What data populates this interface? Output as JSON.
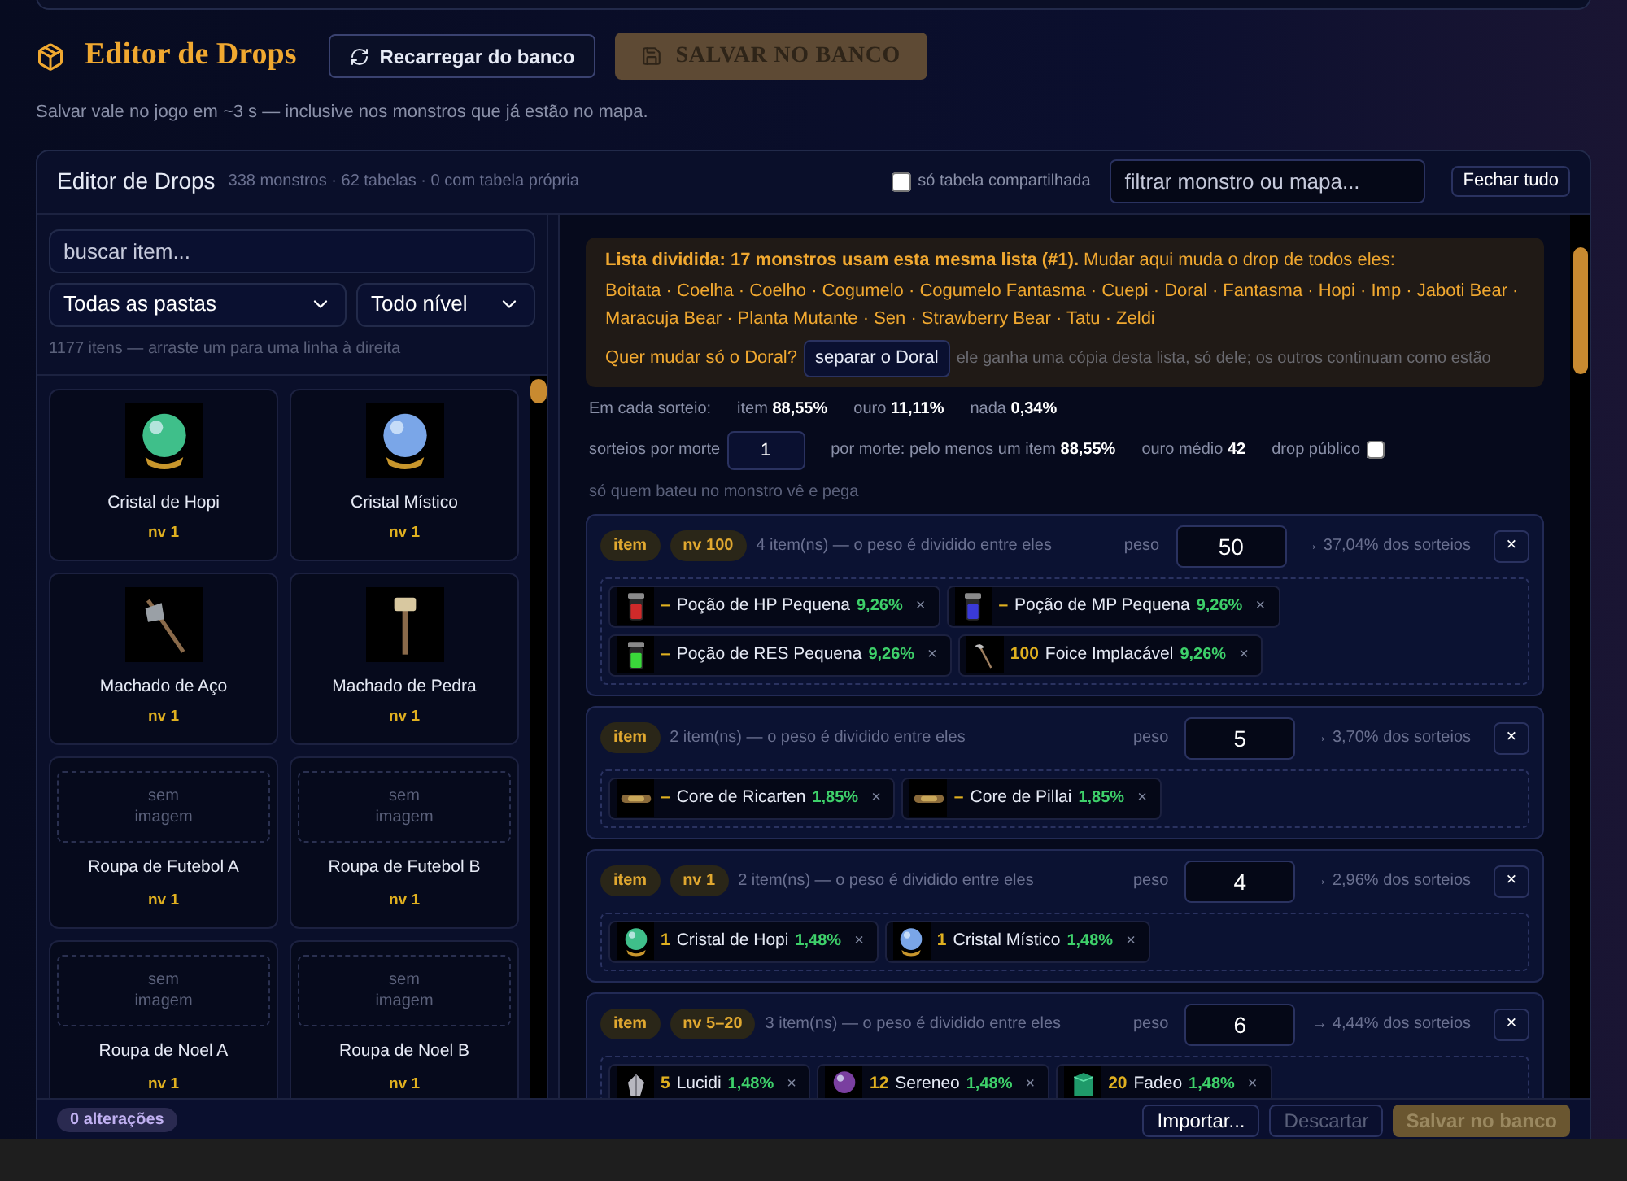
{
  "header": {
    "title": "Editor de Drops",
    "reload_button": "Recarregar do banco",
    "save_button": {
      "label": "SALVAR NO BANCO",
      "disabled": true
    },
    "subtitle": "Salvar vale no jogo em ~3 s — inclusive nos monstros que já estão no mapa."
  },
  "panel": {
    "title": "Editor de Drops",
    "meta": "338 monstros · 62 tabelas · 0 com tabela própria",
    "shared_only": {
      "label": "só tabela compartilhada",
      "checked": false
    },
    "filter": {
      "placeholder": "filtrar monstro ou mapa..."
    },
    "close_all": "Fechar tudo"
  },
  "sidebar": {
    "search": {
      "placeholder": "buscar item..."
    },
    "folder_select": "Todas as pastas",
    "level_select": "Todo nível",
    "hint": "1177 itens — arraste um para uma linha à direita",
    "items": [
      {
        "kind": "image",
        "name": "Cristal de Hopi",
        "level": "nv 1"
      },
      {
        "kind": "image",
        "name": "Cristal Místico",
        "level": "nv 1"
      },
      {
        "kind": "image",
        "name": "Machado de Aço",
        "level": "nv 1"
      },
      {
        "kind": "image",
        "name": "Machado de Pedra",
        "level": "nv 1"
      },
      {
        "kind": "placeholder",
        "placeholder": "sem imagem",
        "name": "Roupa de Futebol A",
        "level": "nv 1"
      },
      {
        "kind": "placeholder",
        "placeholder": "sem imagem",
        "name": "Roupa de Futebol B",
        "level": "nv 1"
      },
      {
        "kind": "placeholder",
        "placeholder": "sem imagem",
        "name": "Roupa de Noel A",
        "level": "nv 1"
      },
      {
        "kind": "placeholder",
        "placeholder": "sem imagem",
        "name": "Roupa de Noel B",
        "level": "nv 1"
      }
    ]
  },
  "editor": {
    "notice": {
      "text": "**Lista dividida: 17 monstros usam esta mesma lista (#1).** Mudar aqui muda o drop de todos eles:",
      "monsters": "Boitata · Coelha · Coelho · Cogumelo · Cogumelo Fantasma · Cuepi · Doral · Fantasma · Hopi · Imp · Jaboti Bear · Maracuja Bear · Planta Mutante · Sen · Strawberry Bear · Tatu · Zeldi",
      "question": "Quer mudar só o Doral?",
      "split_button": "separar o Doral",
      "note": "ele ganha uma cópia desta lista, só dele; os outros continuam como estão"
    },
    "per_draw": {
      "label": "Em cada sorteio:",
      "stats": [
        "item **88,55%**",
        "ouro **11,11%**",
        "nada **0,34%**"
      ]
    },
    "per_kill": {
      "label": "sorteios por morte",
      "value": "1",
      "stats": [
        "por morte: pelo menos um item **88,55%**",
        "ouro médio **42**"
      ],
      "public_drop": {
        "label": "drop público",
        "checked": false
      }
    },
    "help": "só quem bateu no monstro vê e pega",
    "groups": [
      {
        "badges": [
          "item",
          "nv 100"
        ],
        "summary": "4 item(ns) — o peso é dividido entre eles",
        "weight_label": "peso",
        "weight": "50",
        "share": "→ 37,04% dos sorteios",
        "close": "×",
        "items": [
          {
            "qty": "–",
            "name": "Poção de HP Pequena",
            "pct": "9,26%",
            "remove": "×"
          },
          {
            "qty": "–",
            "name": "Poção de MP Pequena",
            "pct": "9,26%",
            "remove": "×"
          },
          {
            "qty": "–",
            "name": "Poção de RES Pequena",
            "pct": "9,26%",
            "remove": "×"
          },
          {
            "qty": "100",
            "name": "Foice Implacável",
            "pct": "9,26%",
            "remove": "×"
          }
        ]
      },
      {
        "badges": [
          "item"
        ],
        "summary": "2 item(ns) — o peso é dividido entre eles",
        "weight_label": "peso",
        "weight": "5",
        "share": "→ 3,70% dos sorteios",
        "close": "×",
        "items": [
          {
            "qty": "–",
            "name": "Core de Ricarten",
            "pct": "1,85%",
            "remove": "×"
          },
          {
            "qty": "–",
            "name": "Core de Pillai",
            "pct": "1,85%",
            "remove": "×"
          }
        ]
      },
      {
        "badges": [
          "item",
          "nv 1"
        ],
        "summary": "2 item(ns) — o peso é dividido entre eles",
        "weight_label": "peso",
        "weight": "4",
        "share": "→ 2,96% dos sorteios",
        "close": "×",
        "items": [
          {
            "qty": "1",
            "name": "Cristal de Hopi",
            "pct": "1,48%",
            "remove": "×"
          },
          {
            "qty": "1",
            "name": "Cristal Místico",
            "pct": "1,48%",
            "remove": "×"
          }
        ]
      },
      {
        "badges": [
          "item",
          "nv 5–20"
        ],
        "summary": "3 item(ns) — o peso é dividido entre eles",
        "weight_label": "peso",
        "weight": "6",
        "share": "→ 4,44% dos sorteios",
        "close": "×",
        "items": [
          {
            "qty": "5",
            "name": "Lucidi",
            "pct": "1,48%",
            "remove": "×"
          },
          {
            "qty": "12",
            "name": "Sereneo",
            "pct": "1,48%",
            "remove": "×"
          },
          {
            "qty": "20",
            "name": "Fadeo",
            "pct": "1,48%",
            "remove": "×"
          }
        ]
      }
    ]
  },
  "footer": {
    "changes": "0 alterações",
    "import_button": "Importar...",
    "discard_button": "Descartar",
    "save_button": "Salvar no banco"
  }
}
